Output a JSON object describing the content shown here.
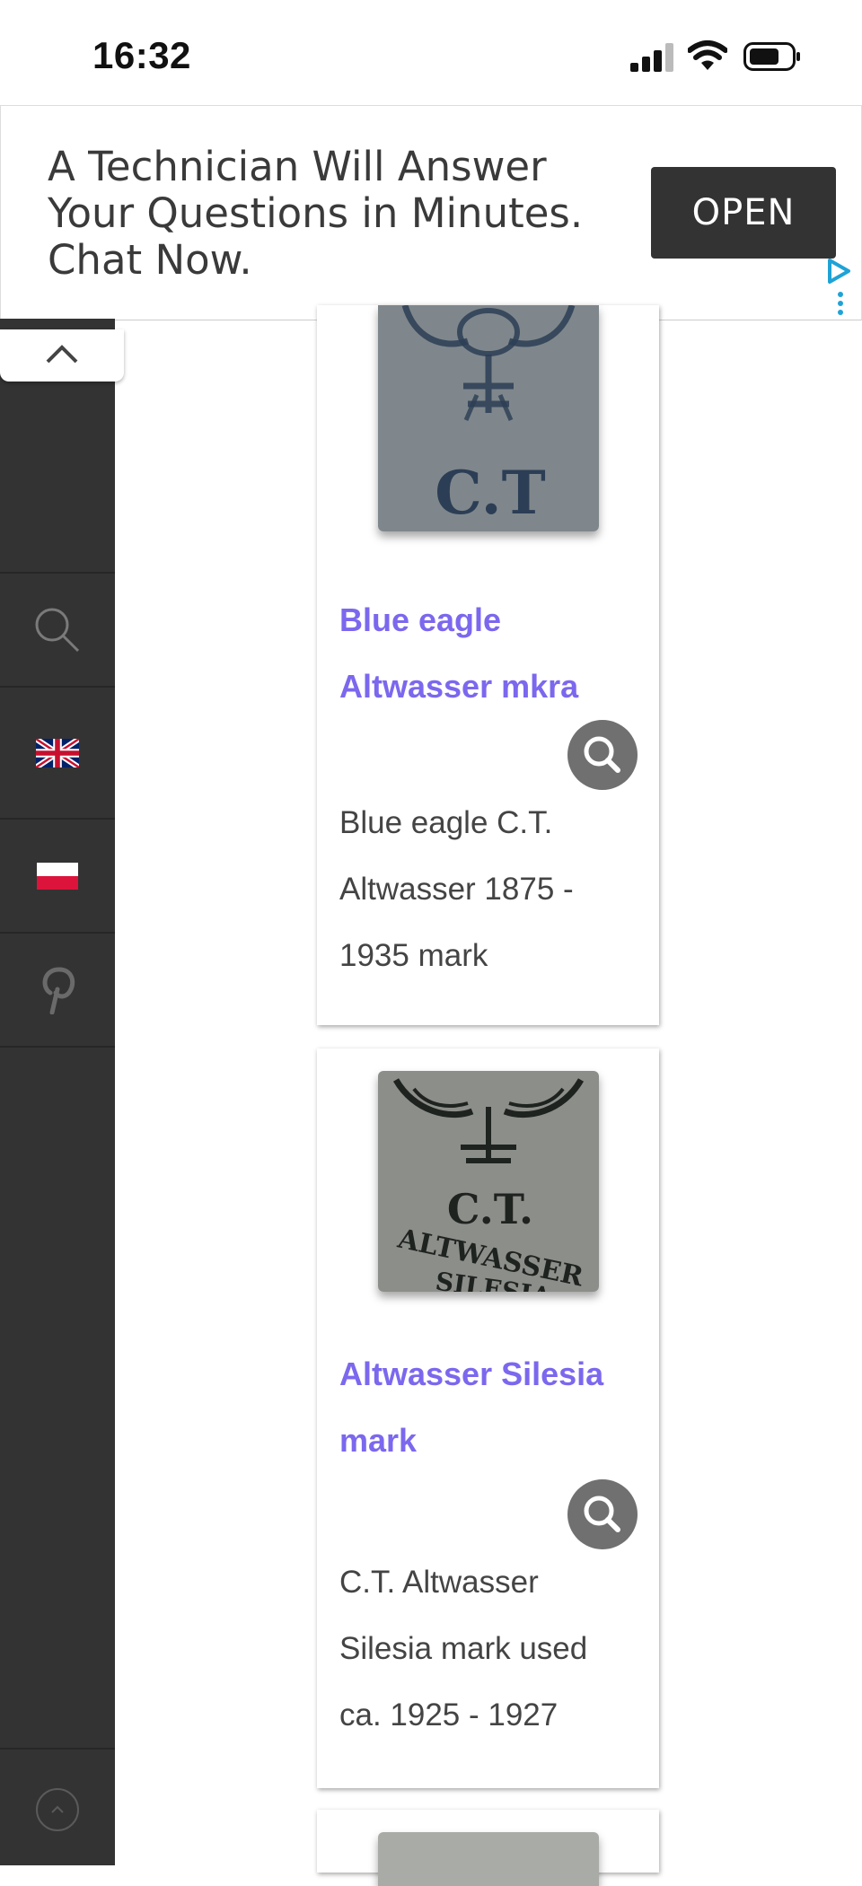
{
  "status_bar": {
    "time": "16:32"
  },
  "ad": {
    "text": "A Technician Will Answer Your Questions in Minutes. Chat Now.",
    "button_label": "OPEN"
  },
  "sidebar": {
    "items": [
      {
        "icon": "search-icon"
      },
      {
        "icon": "uk-flag-icon"
      },
      {
        "icon": "poland-flag-icon"
      },
      {
        "icon": "pinterest-icon"
      }
    ],
    "bottom_icon": "scroll-to-top-icon"
  },
  "cards": [
    {
      "image_text": "C.T",
      "title": "Blue eagle Altwasser mkra",
      "description": "Blue eagle C.T. Altwasser 1875 - 1935 mark"
    },
    {
      "image_text": "C.T.",
      "image_text_2": "ALTWASSER",
      "image_text_3": "SILESIA",
      "title": "Altwasser Silesia mark",
      "description": "C.T. Altwasser Silesia mark used ca. 1925 - 1927"
    }
  ],
  "colors": {
    "title_link": "#7b68ee",
    "sidebar_bg": "#333333",
    "ad_button_bg": "#333333",
    "zoom_button_bg": "#707070"
  }
}
